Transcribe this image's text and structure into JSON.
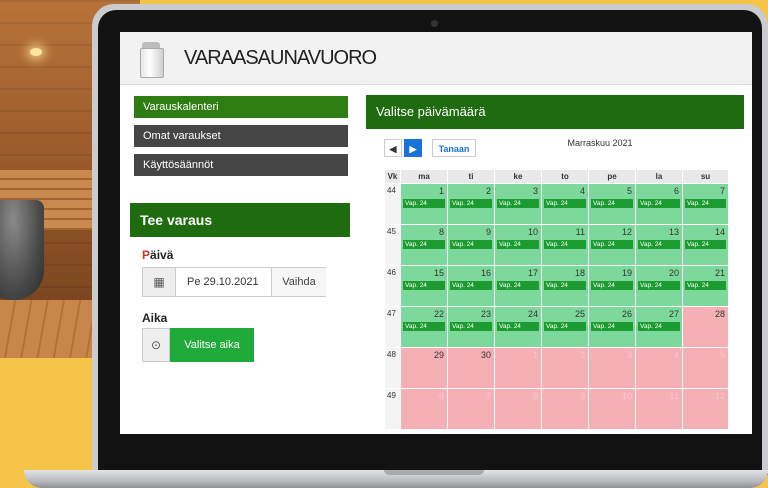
{
  "header": {
    "brand": "VARAASAUNAVUORO"
  },
  "menu": {
    "items": [
      {
        "label": "Varauskalenteri",
        "active": true
      },
      {
        "label": "Omat varaukset",
        "active": false
      },
      {
        "label": "Käyttösäännöt",
        "active": false
      }
    ]
  },
  "booking": {
    "title": "Tee varaus",
    "day_label": "Päivä",
    "date_value": "Pe 29.10.2021",
    "change_label": "Vaihda",
    "time_label": "Aika",
    "time_button": "Valitse aika",
    "calendar_icon": "▦",
    "clock_icon": "⊙"
  },
  "calendar": {
    "title": "Valitse päivämäärä",
    "prev_label": "◀",
    "next_label": "▶",
    "today_label": "Tanaan",
    "month": "Marraskuu 2021",
    "headers": [
      "Vk",
      "ma",
      "ti",
      "ke",
      "to",
      "pe",
      "la",
      "su"
    ],
    "slot_label": "Vap. 24",
    "colors": {
      "available": "#7dd99b",
      "full": "#f5b0b5",
      "slot": "#1c9c30",
      "header": "#1e6b10"
    },
    "weeks": [
      {
        "week": "44",
        "days": [
          {
            "d": "1",
            "s": "avail"
          },
          {
            "d": "2",
            "s": "avail"
          },
          {
            "d": "3",
            "s": "avail"
          },
          {
            "d": "4",
            "s": "avail"
          },
          {
            "d": "5",
            "s": "avail"
          },
          {
            "d": "6",
            "s": "avail"
          },
          {
            "d": "7",
            "s": "avail"
          }
        ]
      },
      {
        "week": "45",
        "days": [
          {
            "d": "8",
            "s": "avail"
          },
          {
            "d": "9",
            "s": "avail"
          },
          {
            "d": "10",
            "s": "avail"
          },
          {
            "d": "11",
            "s": "avail"
          },
          {
            "d": "12",
            "s": "avail"
          },
          {
            "d": "13",
            "s": "avail"
          },
          {
            "d": "14",
            "s": "avail"
          }
        ]
      },
      {
        "week": "46",
        "days": [
          {
            "d": "15",
            "s": "avail"
          },
          {
            "d": "16",
            "s": "avail"
          },
          {
            "d": "17",
            "s": "avail"
          },
          {
            "d": "18",
            "s": "avail"
          },
          {
            "d": "19",
            "s": "avail"
          },
          {
            "d": "20",
            "s": "avail"
          },
          {
            "d": "21",
            "s": "avail"
          }
        ]
      },
      {
        "week": "47",
        "days": [
          {
            "d": "22",
            "s": "avail"
          },
          {
            "d": "23",
            "s": "avail"
          },
          {
            "d": "24",
            "s": "avail"
          },
          {
            "d": "25",
            "s": "avail"
          },
          {
            "d": "26",
            "s": "avail"
          },
          {
            "d": "27",
            "s": "avail"
          },
          {
            "d": "28",
            "s": "full"
          }
        ]
      },
      {
        "week": "48",
        "days": [
          {
            "d": "29",
            "s": "full"
          },
          {
            "d": "30",
            "s": "full"
          },
          {
            "d": "1",
            "s": "faded"
          },
          {
            "d": "2",
            "s": "faded"
          },
          {
            "d": "3",
            "s": "faded"
          },
          {
            "d": "4",
            "s": "faded"
          },
          {
            "d": "5",
            "s": "faded"
          }
        ]
      },
      {
        "week": "49",
        "days": [
          {
            "d": "6",
            "s": "faded"
          },
          {
            "d": "7",
            "s": "faded"
          },
          {
            "d": "8",
            "s": "faded"
          },
          {
            "d": "9",
            "s": "faded"
          },
          {
            "d": "10",
            "s": "faded"
          },
          {
            "d": "11",
            "s": "faded"
          },
          {
            "d": "12",
            "s": "faded"
          }
        ]
      }
    ]
  }
}
